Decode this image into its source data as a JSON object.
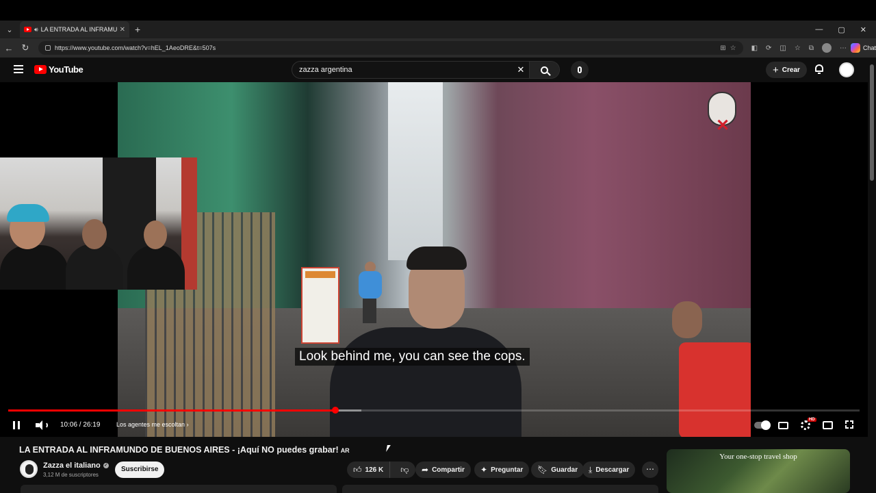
{
  "browser": {
    "tab_title": "LA ENTRADA AL INFRAMUNDO",
    "tab_close": "✕",
    "new_tab": "+",
    "url": "https://www.youtube.com/watch?v=hEL_1AeoDRE&t=507s",
    "chat_label": "Chat",
    "window_controls": [
      "—",
      "▢",
      "✕"
    ]
  },
  "youtube": {
    "logo_text": "YouTube",
    "search_query": "zazza argentina",
    "create_label": "Crear"
  },
  "player": {
    "caption": "Look behind me, you can see the cops.",
    "time": "10:06 / 26:19",
    "chapter": "Los agentes me escoltan",
    "progress_played": 0.3844,
    "progress_loaded": 0.415,
    "hd_badge": "HD"
  },
  "video": {
    "title": "LA ENTRADA AL INFRAMUNDO DE BUENOS AIRES - ¡Aquí NO puedes grabar!",
    "title_flag": "AR",
    "channel_name": "Zazza el italiano",
    "subscribers": "3,12 M de suscriptores",
    "subscribe_label": "Suscribirse",
    "likes": "126 K",
    "share_label": "Compartir",
    "ask_label": "Preguntar",
    "save_label": "Guardar",
    "download_label": "Descargar"
  },
  "ad": {
    "text": "Your one-stop travel shop"
  },
  "colors": {
    "brand_red": "#ff0000",
    "background": "#0f0f0f"
  }
}
